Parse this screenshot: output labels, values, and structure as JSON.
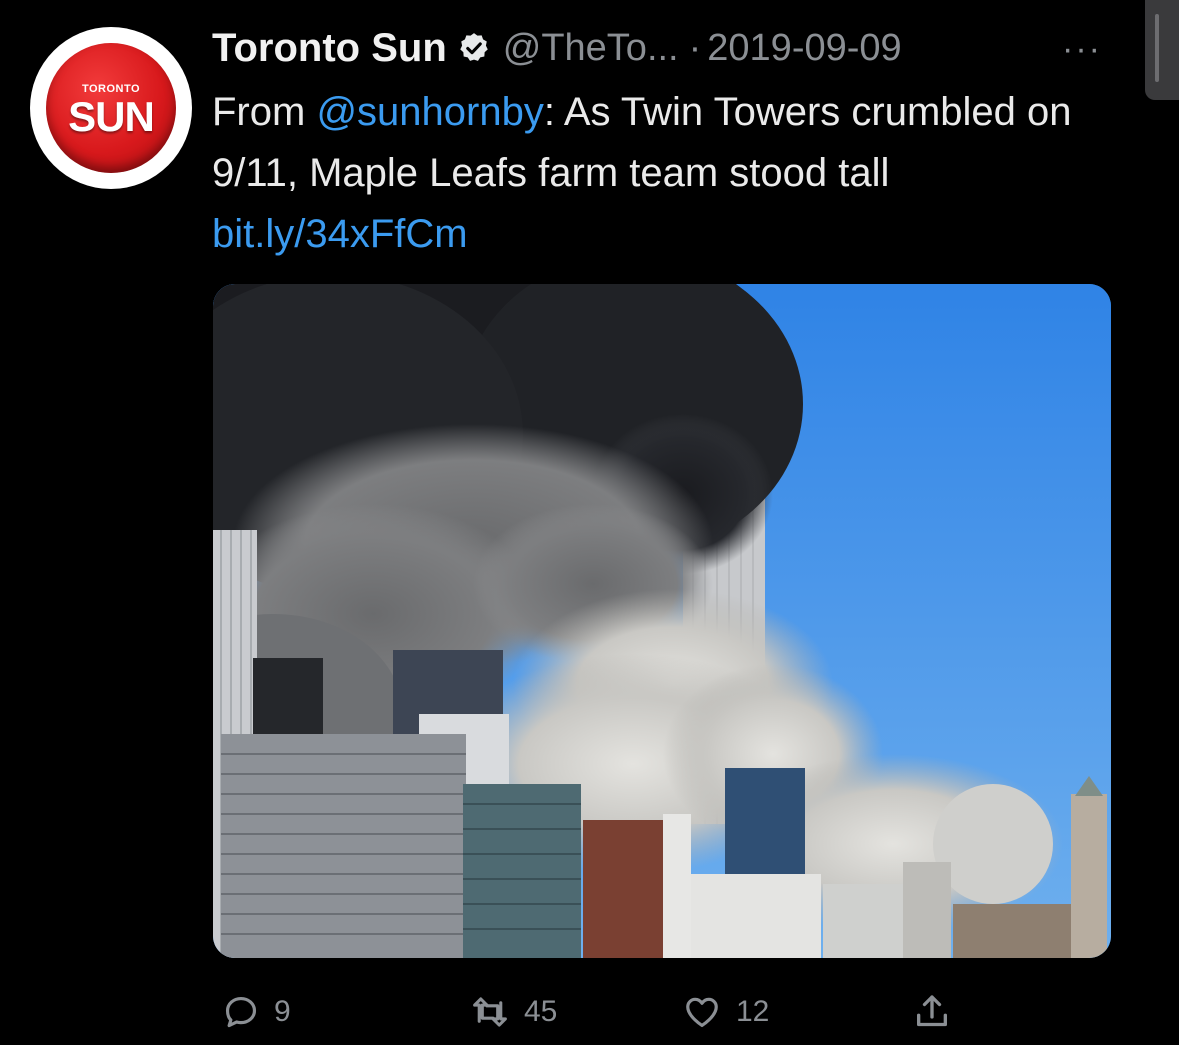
{
  "tweet": {
    "avatar": {
      "small_text": "TORONTO",
      "big_text": "SUN"
    },
    "author_name": "Toronto Sun",
    "verified_icon": "verified-badge-icon",
    "handle": "@TheTo...",
    "separator": "·",
    "date": "2019-09-09",
    "more": "···",
    "text_prefix": "From ",
    "mention": "@sunhornby",
    "text_body": ": As Twin Towers crumbled on 9/11, Maple Leafs farm team stood tall ",
    "link": "bit.ly/34xFfCm",
    "link_color": "#3b9bf0",
    "media_icon": "news-photo",
    "actions": {
      "reply_count": "9",
      "retweet_count": "45",
      "like_count": "12"
    }
  }
}
